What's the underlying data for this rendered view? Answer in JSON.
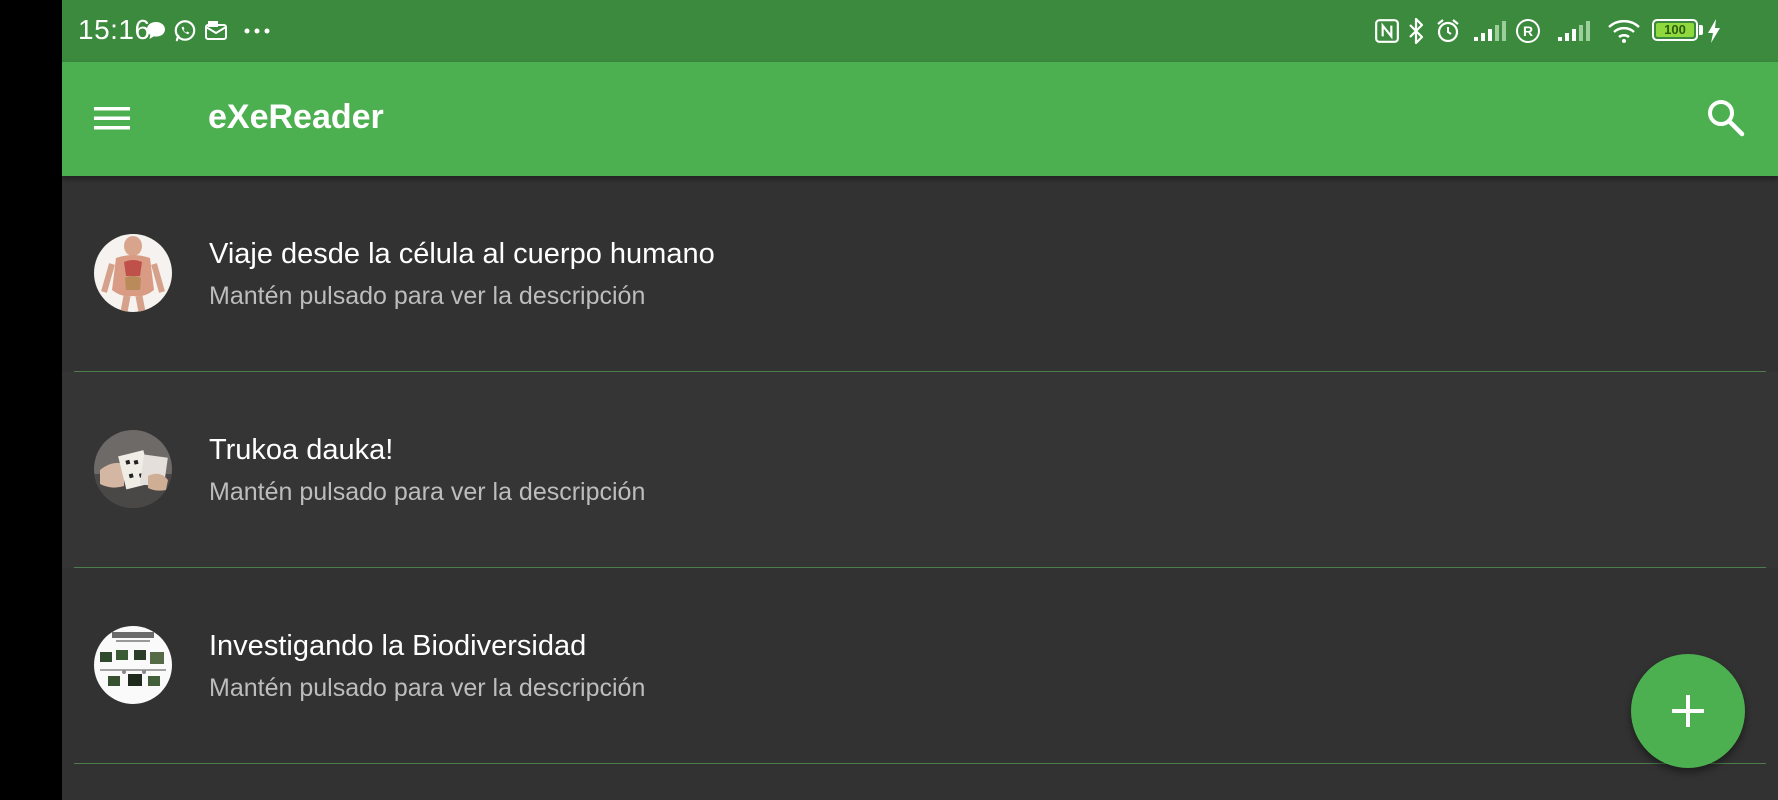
{
  "status_bar": {
    "time": "15:16",
    "battery_level": "100",
    "icons": [
      "chat-bubble-icon",
      "whatsapp-icon",
      "mail-icon",
      "more-dots-icon",
      "nfc-icon",
      "bluetooth-icon",
      "alarm-icon",
      "signal-icon",
      "roaming-icon",
      "signal-icon",
      "wifi-icon",
      "battery-icon",
      "charging-icon"
    ]
  },
  "app_bar": {
    "title": "eXeReader",
    "menu_icon": "menu-icon",
    "search_icon": "search-icon"
  },
  "books": [
    {
      "title": "Viaje desde la célula al cuerpo humano",
      "subtitle": "Mantén pulsado para ver la descripción"
    },
    {
      "title": "Trukoa dauka!",
      "subtitle": "Mantén pulsado para ver la descripción"
    },
    {
      "title": "Investigando la Biodiversidad",
      "subtitle": "Mantén pulsado para ver la descripción"
    }
  ],
  "fab": {
    "icon": "add-icon"
  },
  "colors": {
    "status_bar": "#3b8a3e",
    "app_bar": "#4caf50",
    "background": "#323232",
    "divider": "#4c7d4c"
  }
}
